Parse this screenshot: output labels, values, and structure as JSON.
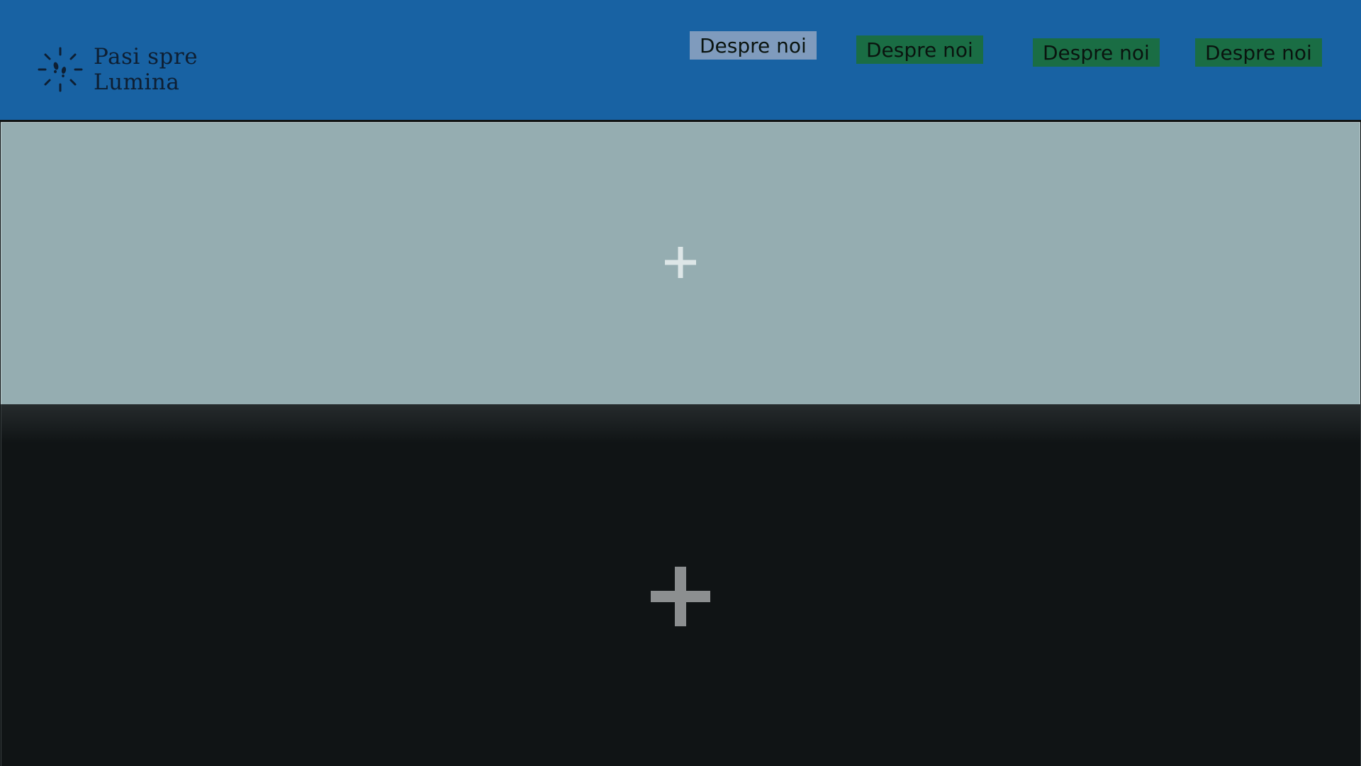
{
  "header": {
    "logo": {
      "icon": "sun-footprints-icon",
      "line1": "Pasi spre",
      "line2": "Lumina"
    },
    "nav": [
      {
        "label": "Despre noi",
        "active": true
      },
      {
        "label": "Despre noi",
        "active": false
      },
      {
        "label": "Despre noi",
        "active": false
      },
      {
        "label": "Despre noi",
        "active": false
      }
    ]
  },
  "sections": {
    "top": {
      "add_icon": "plus-icon"
    },
    "bottom": {
      "add_icon": "plus-icon"
    }
  },
  "colors": {
    "header_bg": "#1862a3",
    "nav_active_bg": "#7f9bbd",
    "nav_bg": "#1a6d44",
    "top_section_bg": "#95adb1",
    "bottom_section_bg": "#101415"
  }
}
